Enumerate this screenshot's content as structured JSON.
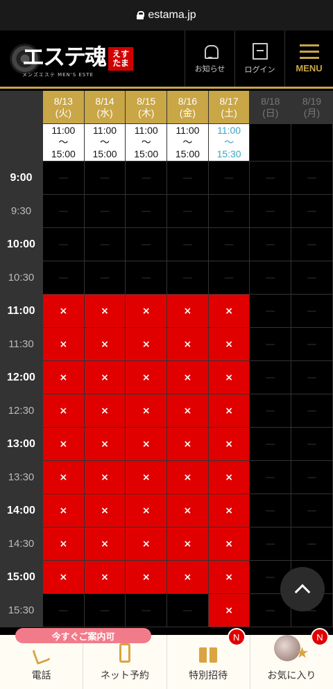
{
  "browser": {
    "url": "estama.jp"
  },
  "header": {
    "logo_text": "エステ魂",
    "logo_sub": "メンズエステ MEN'S ESTE",
    "logo_stamp": "えす たま",
    "notice_label": "お知らせ",
    "login_label": "ログイン",
    "menu_label": "MENU"
  },
  "schedule": {
    "days": [
      {
        "date": "8/13",
        "dow": "(火)",
        "open": true,
        "from": "11:00",
        "sep": "〜",
        "to": "15:00",
        "highlight": false
      },
      {
        "date": "8/14",
        "dow": "(水)",
        "open": true,
        "from": "11:00",
        "sep": "〜",
        "to": "15:00",
        "highlight": false
      },
      {
        "date": "8/15",
        "dow": "(木)",
        "open": true,
        "from": "11:00",
        "sep": "〜",
        "to": "15:00",
        "highlight": false
      },
      {
        "date": "8/16",
        "dow": "(金)",
        "open": true,
        "from": "11:00",
        "sep": "〜",
        "to": "15:00",
        "highlight": false
      },
      {
        "date": "8/17",
        "dow": "(土)",
        "open": true,
        "from": "11:00",
        "sep": "〜",
        "to": "15:30",
        "highlight": true
      },
      {
        "date": "8/18",
        "dow": "(日)",
        "open": false
      },
      {
        "date": "8/19",
        "dow": "(月)",
        "open": false
      }
    ],
    "times": [
      "9:00",
      "9:30",
      "10:00",
      "10:30",
      "11:00",
      "11:30",
      "12:00",
      "12:30",
      "13:00",
      "13:30",
      "14:00",
      "14:30",
      "15:00",
      "15:30"
    ],
    "full_mark": "×",
    "empty_mark": "—",
    "grid": [
      [
        "na",
        "na",
        "na",
        "na",
        "na",
        "na",
        "na"
      ],
      [
        "na",
        "na",
        "na",
        "na",
        "na",
        "na",
        "na"
      ],
      [
        "na",
        "na",
        "na",
        "na",
        "na",
        "na",
        "na"
      ],
      [
        "na",
        "na",
        "na",
        "na",
        "na",
        "na",
        "na"
      ],
      [
        "full",
        "full",
        "full",
        "full",
        "full",
        "na",
        "na"
      ],
      [
        "full",
        "full",
        "full",
        "full",
        "full",
        "na",
        "na"
      ],
      [
        "full",
        "full",
        "full",
        "full",
        "full",
        "na",
        "na"
      ],
      [
        "full",
        "full",
        "full",
        "full",
        "full",
        "na",
        "na"
      ],
      [
        "full",
        "full",
        "full",
        "full",
        "full",
        "na",
        "na"
      ],
      [
        "full",
        "full",
        "full",
        "full",
        "full",
        "na",
        "na"
      ],
      [
        "full",
        "full",
        "full",
        "full",
        "full",
        "na",
        "na"
      ],
      [
        "full",
        "full",
        "full",
        "full",
        "full",
        "na",
        "na"
      ],
      [
        "full",
        "full",
        "full",
        "full",
        "full",
        "na",
        "na"
      ],
      [
        "na",
        "na",
        "na",
        "na",
        "full",
        "na",
        "na"
      ]
    ]
  },
  "bottom_bar": {
    "pill": "今すぐご案内可",
    "items": [
      {
        "label": "電話",
        "icon": "phone-icon",
        "badge": ""
      },
      {
        "label": "ネット予約",
        "icon": "mobile-icon",
        "badge": ""
      },
      {
        "label": "特別招待",
        "icon": "gift-icon",
        "badge": "N"
      },
      {
        "label": "お気に入り",
        "icon": "avatar-star-icon",
        "badge": "N"
      }
    ]
  },
  "colors": {
    "gold": "#c9a646",
    "red": "#e00000",
    "cyan": "#3aa6c4",
    "pink": "#f27b8a"
  }
}
